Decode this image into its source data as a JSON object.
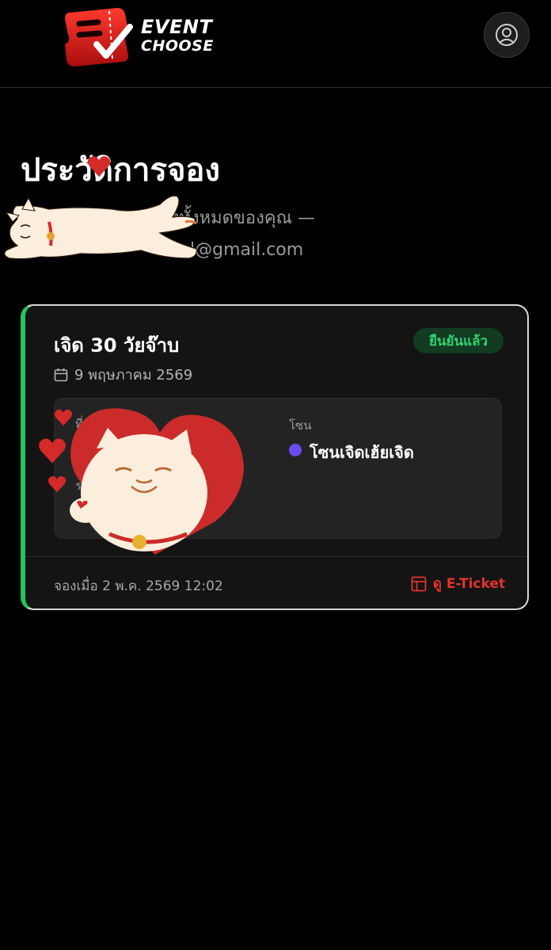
{
  "brand": {
    "line1": "EVENT",
    "line2": "CHOOSE"
  },
  "header": {
    "account_icon": "user-circle-icon"
  },
  "page": {
    "title": "ประวัติการจอง",
    "subtitle_line1": "การจองทั้งหมดของคุณ —",
    "subtitle_line2": "l@gmail.com"
  },
  "booking": {
    "event_name": "เจิด 30 วัยจ๊าบ",
    "status": "ยืนยันแล้ว",
    "date": "9 พฤษภาคม 2569",
    "venue_label": "ที่",
    "seat_label": "ร",
    "zone_label": "โซน",
    "zone_value": "โซนเจิดเฮ้ยเจิด",
    "booked_at": "จองเมื่อ 2 พ.ค. 2569 12:02",
    "eticket_label": "ดู E-Ticket"
  },
  "colors": {
    "accent_red": "#e5322d",
    "status_green": "#22c55e",
    "zone_dot": "#6a4cf0"
  },
  "icons": [
    "calendar-icon",
    "ticket-icon",
    "user-circle-icon"
  ]
}
